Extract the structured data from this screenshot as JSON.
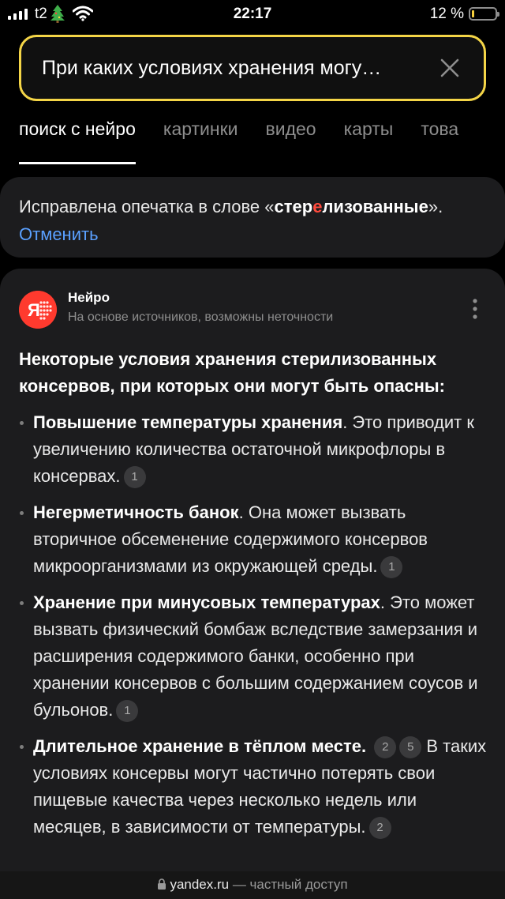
{
  "status_bar": {
    "carrier": "t2",
    "time": "22:17",
    "battery_percent": "12 %",
    "battery_level": 0.12,
    "icons": [
      "signal-icon",
      "tree-icon",
      "wifi-icon",
      "battery-icon"
    ]
  },
  "search": {
    "query": "При каких условиях хранения могу…",
    "clear_icon": "close-icon"
  },
  "tabs": [
    {
      "label": "поиск с нейро",
      "active": true
    },
    {
      "label": "картинки",
      "active": false
    },
    {
      "label": "видео",
      "active": false
    },
    {
      "label": "карты",
      "active": false
    },
    {
      "label": "това",
      "active": false
    }
  ],
  "typo_notice": {
    "prefix": "Исправлена опечатка в слове «",
    "word_part1": "стер",
    "word_highlight": "е",
    "word_part2": "лизованные",
    "suffix": "».",
    "cancel_label": "Отменить"
  },
  "neuro": {
    "name": "Нейро",
    "subtitle": "На основе источников, возможны неточности",
    "answer_title": "Некоторые условия хранения стерилизованных консервов, при которых они могут быть опасны:",
    "items": [
      {
        "bold": "Повышение температуры хранения",
        "text": ". Это приводит к увеличению количества остаточной микрофлоры в консервах.",
        "citations": [
          "1"
        ]
      },
      {
        "bold": "Негерметичность банок",
        "text": ". Она может вызвать вторичное обсеменение содержимого консервов микроорганизмами из окружающей среды.",
        "citations": [
          "1"
        ]
      },
      {
        "bold": "Хранение при минусовых температурах",
        "text": ". Это может вызвать физический бомбаж вследствие замерзания и расширения содержимого банки, особенно при хранении консервов с большим содержанием соусов и бульонов.",
        "citations": [
          "1"
        ]
      },
      {
        "bold": "Длительное хранение в тёплом месте",
        "text_before": ".",
        "citations_mid": [
          "2",
          "5"
        ],
        "text": " В таких условиях консервы могут частично потерять свои пищевые качества через несколько недель или месяцев, в зависимости от температуры.",
        "citations": [
          "2"
        ]
      }
    ]
  },
  "url_bar": {
    "domain": "yandex.ru",
    "suffix": " — частный доступ"
  },
  "colors": {
    "accent_yellow": "#f4d547",
    "link_blue": "#5aa0ff",
    "neuro_red": "#ff3a2e",
    "typo_red": "#ff4a3d",
    "card_bg": "#1c1c1e"
  }
}
